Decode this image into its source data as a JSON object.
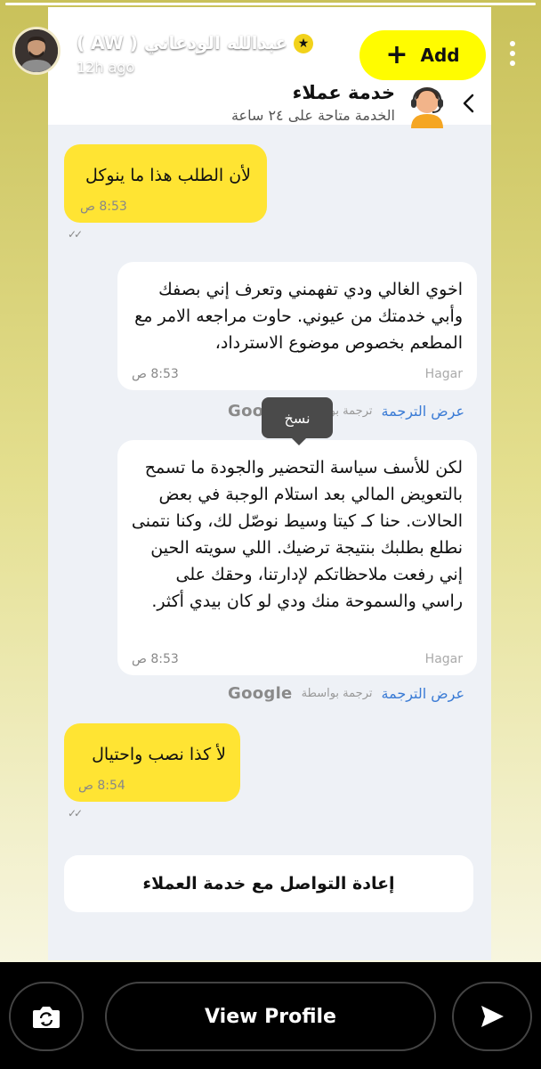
{
  "story": {
    "user_name": "عبدالله الودعاني ( AW )",
    "posted_ago": "12h ago",
    "add_label": "Add",
    "view_profile_label": "View Profile"
  },
  "chat": {
    "header": {
      "title": "خدمة عملاء",
      "subtitle": "الخدمة متاحة على ٢٤ ساعة"
    },
    "messages": [
      {
        "direction": "outgoing",
        "text": "لأن الطلب هذا ما ينوكل",
        "time": "8:53 ص"
      },
      {
        "direction": "incoming",
        "text": "اخوي الغالي ودي تفهمني وتعرف إني بصفك وأبي خدمتك من عيوني. حاوت مراجعه الامر مع المطعم بخصوص موضوع الاسترداد،",
        "sender": "Hagar",
        "time": "8:53 ص",
        "translate_link": "عرض الترجمة",
        "translated_by": "ترجمة بواسطة",
        "provider": "Google"
      },
      {
        "direction": "incoming",
        "text": "لكن للأسف سياسة التحضير والجودة ما تسمح بالتعويض المالي بعد استلام الوجبة في بعض الحالات. حنا كـ كيتا وسيط نوصّل لك، وكنا نتمنى نطلع بطلبك بنتيجة ترضيك. اللي سويته الحين إني رفعت ملاحظاتكم لإدارتنا، وحقك على راسي والسموحة منك ودي لو كان بيدي أكثر.",
        "sender": "Hagar",
        "time": "8:53 ص",
        "translate_link": "عرض الترجمة",
        "translated_by": "ترجمة بواسطة",
        "provider": "Google"
      },
      {
        "direction": "outgoing",
        "text": "لأ كذا نصب واحتيال",
        "time": "8:54 ص"
      }
    ],
    "copy_tooltip": "نسخ",
    "reconnect_label": "إعادة التواصل مع خدمة العملاء"
  },
  "colors": {
    "accent_yellow": "#fffc00",
    "outgoing_bubble": "#ffe433",
    "link_blue": "#3a7bd5"
  },
  "icons": [
    "back-chevron-icon",
    "support-agent-icon",
    "more-icon",
    "camera-swap-icon",
    "send-arrow-icon",
    "star-icon"
  ]
}
